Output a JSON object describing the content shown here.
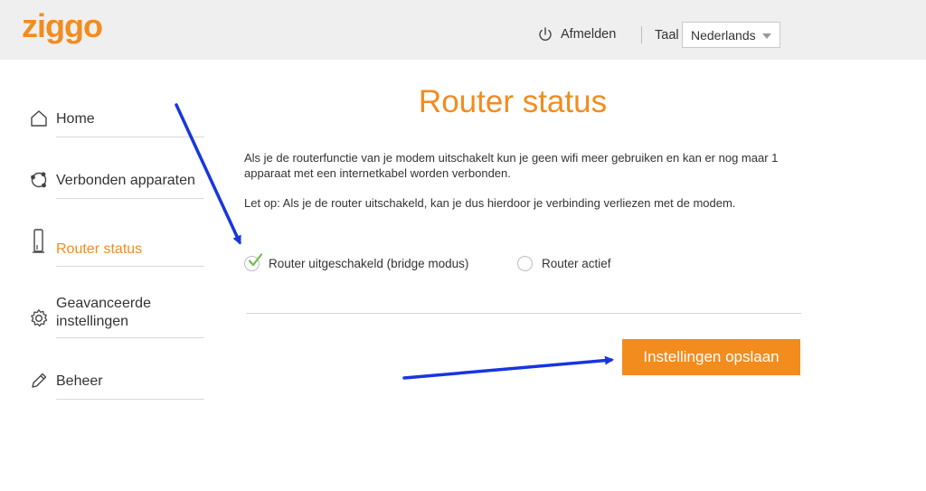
{
  "header": {
    "logo_text": "ziggo",
    "logout_label": "Afmelden",
    "language_label": "Taal",
    "language_selected": "Nederlands"
  },
  "sidebar": {
    "items": [
      {
        "label": "Home",
        "icon": "home-icon"
      },
      {
        "label": "Verbonden apparaten",
        "icon": "devices-icon"
      },
      {
        "label": "Router status",
        "icon": "router-icon",
        "active": true
      },
      {
        "label": "Geavanceerde instellingen",
        "icon": "gear-icon"
      },
      {
        "label": "Beheer",
        "icon": "pencil-icon"
      }
    ]
  },
  "main": {
    "title": "Router status",
    "paragraph1": "Als je de routerfunctie van je modem uitschakelt kun je geen wifi meer gebruiken en kan er nog maar 1 apparaat met een internetkabel worden verbonden.",
    "paragraph2": "Let op: Als je de router uitschakeld, kan je dus hierdoor je verbinding verliezen met de modem.",
    "options": [
      {
        "label": "Router uitgeschakeld (bridge modus)",
        "selected": true
      },
      {
        "label": "Router actief",
        "selected": false
      }
    ],
    "save_label": "Instellingen opslaan"
  },
  "colors": {
    "brand_orange": "#f28c1f",
    "header_bg": "#efefef",
    "check_green": "#6fbf4a",
    "annotation_blue": "#1736e0"
  }
}
